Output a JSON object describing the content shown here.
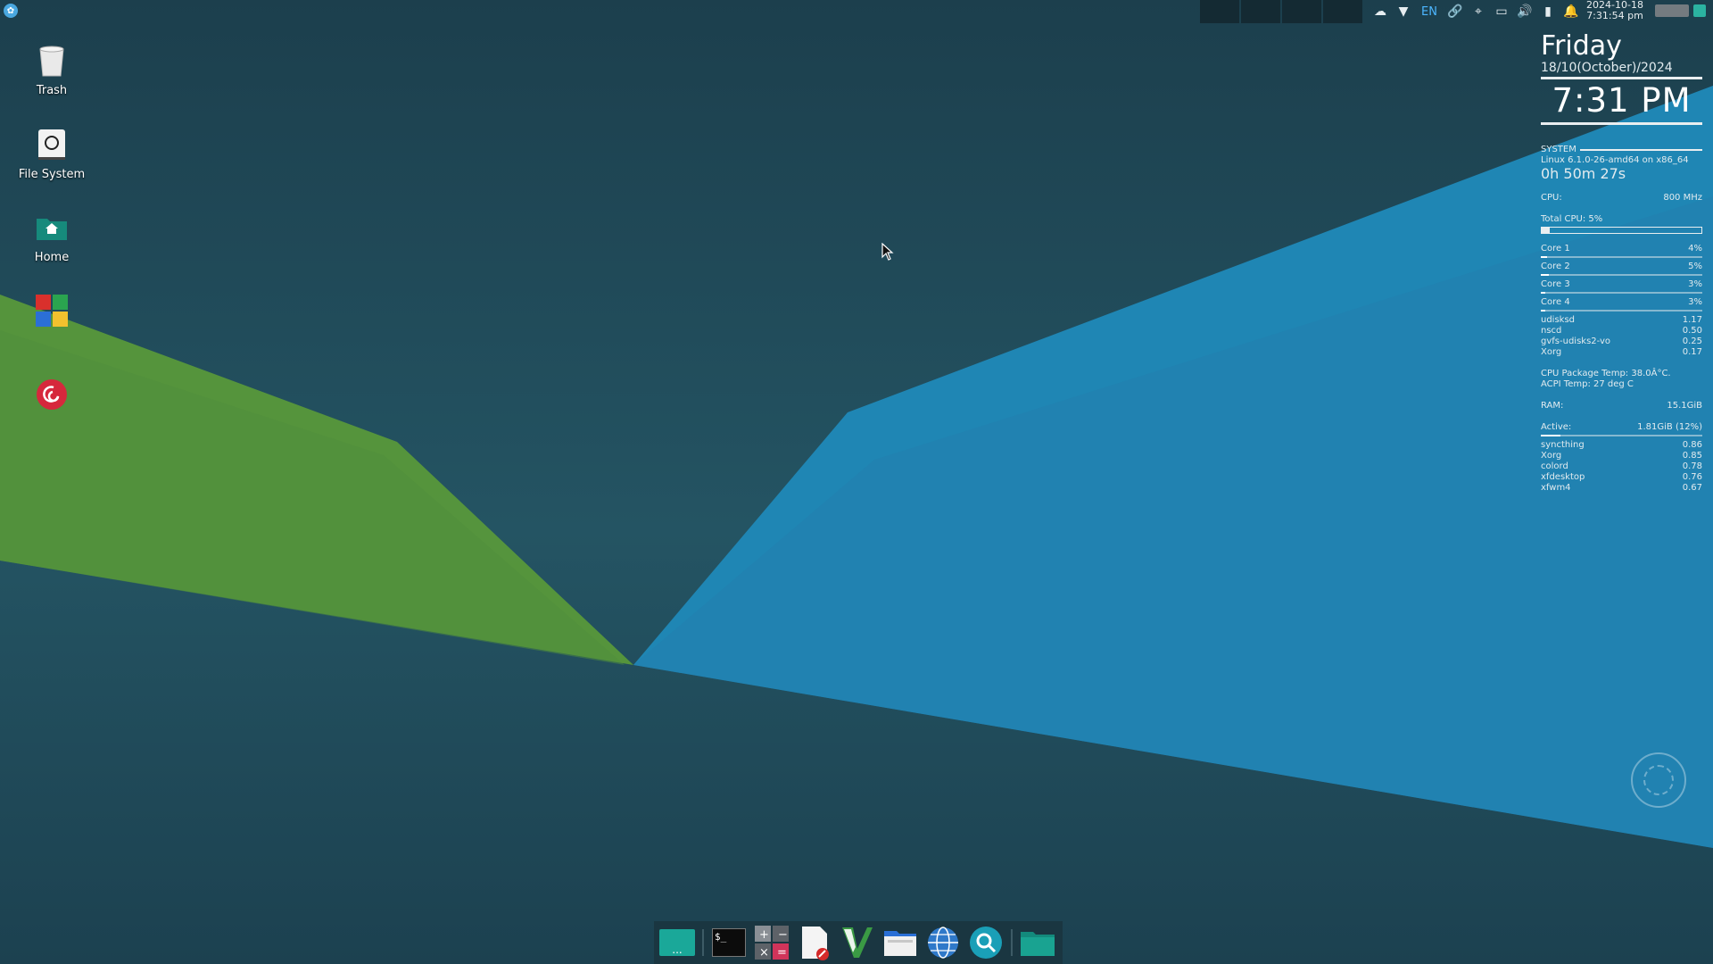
{
  "top_panel": {
    "menu_icon": "whisker-menu-icon",
    "tray_icons": [
      "weather-icon",
      "wifi-icon",
      "link-icon",
      "location-icon",
      "display-icon",
      "volume-icon",
      "clipboard-icon",
      "notification-bell-icon"
    ],
    "language": "EN",
    "clock_date": "2024-10-18",
    "clock_time": "7:31:54 pm"
  },
  "desktop_icons": [
    {
      "label": "Trash",
      "icon": "trash-icon"
    },
    {
      "label": "File System",
      "icon": "drive-icon"
    },
    {
      "label": "Home",
      "icon": "home-folder-icon"
    },
    {
      "label": "",
      "icon": "app-grid-icon"
    },
    {
      "label": "",
      "icon": "debian-swirl-icon"
    }
  ],
  "conky": {
    "day": "Friday",
    "date": "18/10(October)/2024",
    "time": "7:31 PM",
    "system_label": "SYSTEM",
    "kernel": "Linux 6.1.0-26-amd64 on x86_64",
    "uptime": "0h 50m 27s",
    "cpu_label": "CPU:",
    "cpu_freq": "800 MHz",
    "total_cpu": "Total CPU: 5%",
    "total_cpu_pct": 5,
    "cores": [
      {
        "name": "Core 1",
        "value": "4%",
        "pct": 4
      },
      {
        "name": "Core 2",
        "value": "5%",
        "pct": 5
      },
      {
        "name": "Core 3",
        "value": "3%",
        "pct": 3
      },
      {
        "name": "Core 4",
        "value": "3%",
        "pct": 3
      }
    ],
    "cpu_procs": [
      {
        "name": "udisksd",
        "value": "1.17"
      },
      {
        "name": "nscd",
        "value": "0.50"
      },
      {
        "name": "gvfs-udisks2-vo",
        "value": "0.25"
      },
      {
        "name": "Xorg",
        "value": "0.17"
      }
    ],
    "temp_pkg": "CPU Package Temp: 38.0Â°C.",
    "temp_acpi": "ACPI Temp: 27 deg C",
    "ram_label": "RAM:",
    "ram_total": "15.1GiB",
    "active_label": "Active:",
    "active_value": "1.81GiB (12%)",
    "active_pct": 12,
    "mem_procs": [
      {
        "name": "syncthing",
        "value": "0.86"
      },
      {
        "name": "Xorg",
        "value": "0.85"
      },
      {
        "name": "colord",
        "value": "0.78"
      },
      {
        "name": "xfdesktop",
        "value": "0.76"
      },
      {
        "name": "xfwm4",
        "value": "0.67"
      }
    ]
  },
  "dock": {
    "items": [
      "show-desktop-icon",
      "terminal-icon",
      "calculator-icon",
      "text-editor-icon",
      "vim-icon",
      "file-manager-icon",
      "web-browser-icon",
      "search-icon",
      "folder-icon"
    ],
    "terminal_text": "$_",
    "desktop_text": "..."
  },
  "colors": {
    "green": "#5a9a3a",
    "blue": "#1f86b4",
    "background": "#1d4654"
  }
}
